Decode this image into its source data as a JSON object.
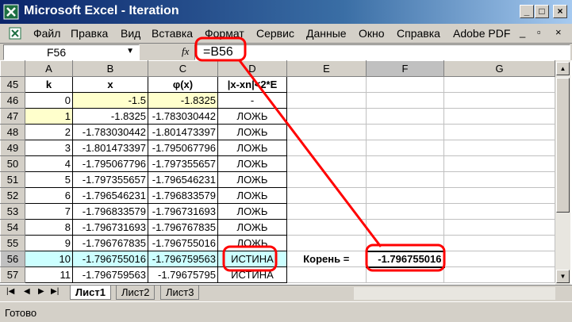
{
  "window": {
    "title": "Microsoft Excel - Iteration"
  },
  "menu": [
    "Файл",
    "Правка",
    "Вид",
    "Вставка",
    "Формат",
    "Сервис",
    "Данные",
    "Окно",
    "Справка",
    "Adobe PDF"
  ],
  "formula_bar": {
    "name_box": "F56",
    "fx": "fx",
    "formula": "=B56"
  },
  "columns": [
    "A",
    "B",
    "C",
    "D",
    "E",
    "F",
    "G"
  ],
  "headers": {
    "row": "45",
    "k": "k",
    "x": "x",
    "phi": "φ(x)",
    "cond": "|x-xn|<2*E"
  },
  "rows": [
    {
      "n": "46",
      "k": "0",
      "x": "-1.5",
      "phi": "-1.8325",
      "cond": "-"
    },
    {
      "n": "47",
      "k": "1",
      "x": "-1.8325",
      "phi": "-1.783030442",
      "cond": "ЛОЖЬ"
    },
    {
      "n": "48",
      "k": "2",
      "x": "-1.783030442",
      "phi": "-1.801473397",
      "cond": "ЛОЖЬ"
    },
    {
      "n": "49",
      "k": "3",
      "x": "-1.801473397",
      "phi": "-1.795067796",
      "cond": "ЛОЖЬ"
    },
    {
      "n": "50",
      "k": "4",
      "x": "-1.795067796",
      "phi": "-1.797355657",
      "cond": "ЛОЖЬ"
    },
    {
      "n": "51",
      "k": "5",
      "x": "-1.797355657",
      "phi": "-1.796546231",
      "cond": "ЛОЖЬ"
    },
    {
      "n": "52",
      "k": "6",
      "x": "-1.796546231",
      "phi": "-1.796833579",
      "cond": "ЛОЖЬ"
    },
    {
      "n": "53",
      "k": "7",
      "x": "-1.796833579",
      "phi": "-1.796731693",
      "cond": "ЛОЖЬ"
    },
    {
      "n": "54",
      "k": "8",
      "x": "-1.796731693",
      "phi": "-1.796767835",
      "cond": "ЛОЖЬ"
    },
    {
      "n": "55",
      "k": "9",
      "x": "-1.796767835",
      "phi": "-1.796755016",
      "cond": "ЛОЖЬ"
    },
    {
      "n": "56",
      "k": "10",
      "x": "-1.796755016",
      "phi": "-1.796759563",
      "cond": "ИСТИНА"
    },
    {
      "n": "57",
      "k": "11",
      "x": "-1.796759563",
      "phi": "-1.79675795",
      "cond": "ИСТИНА"
    }
  ],
  "root": {
    "label": "Корень =",
    "value": "-1.796755016"
  },
  "sheets": [
    "Лист1",
    "Лист2",
    "Лист3"
  ],
  "status": "Готово",
  "colors": {
    "yellow": "#ffffcc",
    "selected_row": "#ccffff",
    "annotation": "#ff0000"
  }
}
